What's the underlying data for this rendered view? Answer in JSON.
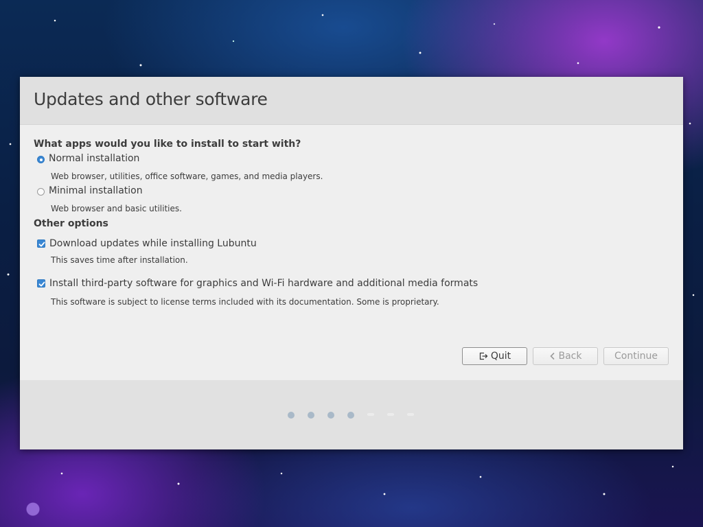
{
  "installer": {
    "title": "Updates and other software",
    "apps_question": "What apps would you like to install to start with?",
    "install_options": [
      {
        "label": "Normal installation",
        "description": "Web browser, utilities, office software, games, and media players.",
        "selected": true
      },
      {
        "label": "Minimal installation",
        "description": "Web browser and basic utilities.",
        "selected": false
      }
    ],
    "other_options_heading": "Other options",
    "other_options": [
      {
        "label": "Download updates while installing Lubuntu",
        "description": "This saves time after installation.",
        "checked": true
      },
      {
        "label": "Install third-party software for graphics and Wi-Fi hardware and additional media formats",
        "description": "This software is subject to license terms included with its documentation. Some is proprietary.",
        "checked": true
      }
    ],
    "buttons": {
      "quit": "Quit",
      "back": "Back",
      "continue": "Continue"
    },
    "progress": {
      "steps_total": 7,
      "steps_completed": 4
    }
  },
  "colors": {
    "accent": "#3a87d3",
    "window_bg": "#efefef",
    "header_bg": "#e0e0e0",
    "progress_dot_done": "#a9b9c8"
  },
  "icons": {
    "quit": "exit-icon",
    "back": "chevron-left-icon"
  }
}
